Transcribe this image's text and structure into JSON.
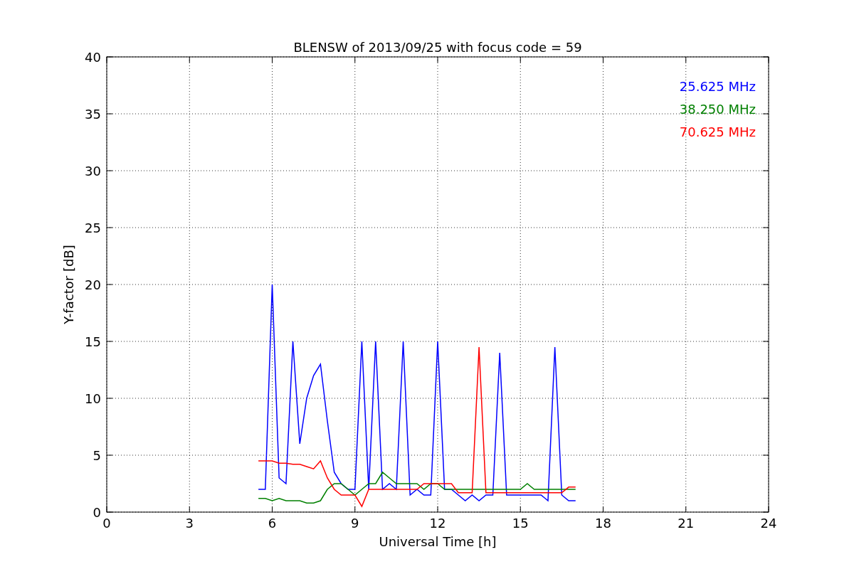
{
  "figure": {
    "chart_data": {
      "type": "line",
      "grid": true,
      "title": "BLENSW of 2013/09/25 with focus code = 59",
      "xlabel": "Universal Time [h]",
      "ylabel": "Y-factor [dB]",
      "xlim": [
        0,
        24
      ],
      "ylim": [
        0,
        40
      ],
      "xticks": [
        0,
        3,
        6,
        9,
        12,
        15,
        18,
        21,
        24
      ],
      "yticks": [
        0,
        5,
        10,
        15,
        20,
        25,
        30,
        35,
        40
      ],
      "x": [
        5.5,
        5.75,
        6,
        6.25,
        6.5,
        6.75,
        7,
        7.25,
        7.5,
        7.75,
        8,
        8.25,
        8.5,
        8.75,
        9,
        9.25,
        9.5,
        9.75,
        10,
        10.25,
        10.5,
        10.75,
        11,
        11.25,
        11.5,
        11.75,
        12,
        12.25,
        12.5,
        12.75,
        13,
        13.25,
        13.5,
        13.75,
        14,
        14.25,
        14.5,
        14.75,
        15,
        15.25,
        15.5,
        15.75,
        16,
        16.25,
        16.5,
        16.75,
        17
      ],
      "series": [
        {
          "name": "25.625 MHz",
          "color": "#0000ff",
          "values": [
            2,
            2,
            20,
            3,
            2.5,
            15,
            6,
            10,
            12,
            13,
            8,
            3.5,
            2.5,
            2,
            2,
            15,
            2,
            15,
            2,
            2.5,
            2,
            15,
            1.5,
            2,
            1.5,
            1.5,
            15,
            2,
            2,
            1.5,
            1,
            1.5,
            1,
            1.5,
            1.5,
            14,
            1.5,
            1.5,
            1.5,
            1.5,
            1.5,
            1.5,
            1,
            14.5,
            1.5,
            1,
            1
          ]
        },
        {
          "name": "38.250 MHz",
          "color": "#008000",
          "values": [
            1.2,
            1.2,
            1,
            1.2,
            1,
            1,
            1,
            0.8,
            0.8,
            1,
            2,
            2.5,
            2.5,
            2,
            1.5,
            2,
            2.5,
            2.5,
            3.5,
            3,
            2.5,
            2.5,
            2.5,
            2.5,
            2,
            2.5,
            2.5,
            2,
            2,
            2,
            2,
            2,
            2,
            2,
            2,
            2,
            2,
            2,
            2,
            2.5,
            2,
            2,
            2,
            2,
            2,
            2,
            2
          ]
        },
        {
          "name": "70.625 MHz",
          "color": "#ff0000",
          "values": [
            4.5,
            4.5,
            4.5,
            4.3,
            4.3,
            4.2,
            4.2,
            4,
            3.8,
            4.5,
            3,
            2,
            1.5,
            1.5,
            1.5,
            0.5,
            2,
            2,
            2,
            2,
            2,
            2,
            2,
            2,
            2.5,
            2.5,
            2.5,
            2.5,
            2.5,
            1.7,
            1.7,
            1.7,
            14.5,
            1.7,
            1.7,
            1.7,
            1.7,
            1.7,
            1.7,
            1.7,
            1.7,
            1.7,
            1.7,
            1.7,
            1.7,
            2.2,
            2.2
          ]
        }
      ]
    }
  }
}
